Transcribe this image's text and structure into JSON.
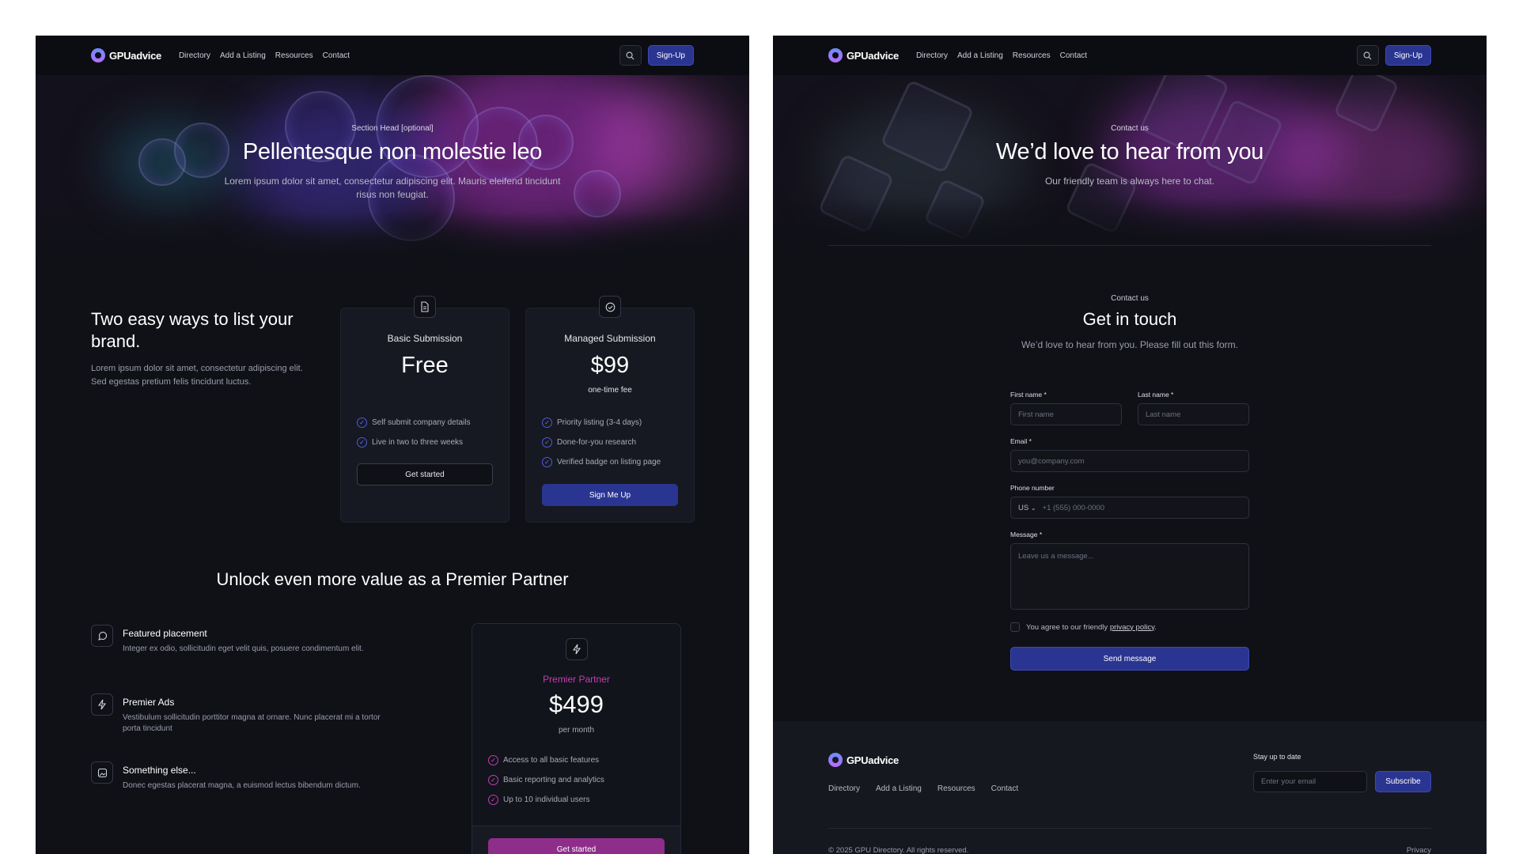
{
  "brand": {
    "name": "GPUadvice"
  },
  "nav": {
    "links": [
      "Directory",
      "Add a Listing",
      "Resources",
      "Contact"
    ],
    "signup_label": "Sign-Up",
    "search_icon": "search-icon"
  },
  "left": {
    "hero": {
      "eyebrow": "Section Head [optional]",
      "title": "Pellentesque non molestie leo",
      "subtitle": "Lorem ipsum dolor sit amet, consectetur adipiscing elit. Mauris eleifend tincidunt risus non feugiat."
    },
    "intro": {
      "title": "Two easy ways to list your brand.",
      "text": "Lorem ipsum dolor sit amet, consectetur adipiscing elit. Sed egestas pretium felis tincidunt luctus."
    },
    "plans": [
      {
        "icon": "document-icon",
        "title": "Basic Submission",
        "price": "Free",
        "note": "",
        "features": [
          "Self submit company details",
          "Live in two to three weeks"
        ],
        "button": "Get started"
      },
      {
        "icon": "check-circle-icon",
        "title": "Managed Submission",
        "price": "$99",
        "note": "one-time fee",
        "features": [
          "Priority listing (3-4 days)",
          "Done-for-you research",
          "Verified badge on listing page"
        ],
        "button": "Sign Me Up"
      }
    ],
    "premier": {
      "heading": "Unlock even more value as a Premier Partner",
      "features": [
        {
          "icon": "chat-icon",
          "title": "Featured placement",
          "text": "Integer ex odio, sollicitudin eget velit quis, posuere condimentum elit."
        },
        {
          "icon": "lightning-icon",
          "title": "Premier Ads",
          "text": "Vestibulum sollicitudin porttitor magna at ornare. Nunc placerat mi a tortor porta tincidunt"
        },
        {
          "icon": "image-icon",
          "title": "Something else...",
          "text": "Donec egestas placerat magna, a euismod lectus bibendum dictum."
        }
      ],
      "card": {
        "icon": "lightning-icon",
        "label": "Premier Partner",
        "price": "$499",
        "note": "per month",
        "features": [
          "Access to all basic features",
          "Basic reporting and analytics",
          "Up to 10 individual users"
        ],
        "button": "Get started"
      }
    }
  },
  "right": {
    "hero": {
      "eyebrow": "Contact us",
      "title": "We’d love to hear from you",
      "subtitle": "Our friendly team is always here to chat."
    },
    "form": {
      "eyebrow": "Contact us",
      "title": "Get in touch",
      "subtitle": "We’d love to hear from you. Please fill out this form.",
      "first_name_label": "First name *",
      "first_name_placeholder": "First name",
      "last_name_label": "Last name *",
      "last_name_placeholder": "Last name",
      "email_label": "Email *",
      "email_placeholder": "you@company.com",
      "phone_label": "Phone number",
      "phone_country": "US",
      "phone_placeholder": "+1 (555) 000-0000",
      "message_label": "Message *",
      "message_placeholder": "Leave us a message...",
      "agree_text": "You agree to our friendly",
      "privacy_link": "privacy policy",
      "agree_end": ".",
      "send_button": "Send message"
    },
    "footer": {
      "links": [
        "Directory",
        "Add a Listing",
        "Resources",
        "Contact"
      ],
      "stay_label": "Stay up to date",
      "email_placeholder": "Enter your email",
      "subscribe": "Subscribe",
      "copyright": "© 2025 GPU Directory. All rights reserved.",
      "privacy": "Privacy"
    }
  },
  "colors": {
    "accent": "#2a3591",
    "premier": "#c23db3",
    "background": "#0f1117"
  }
}
